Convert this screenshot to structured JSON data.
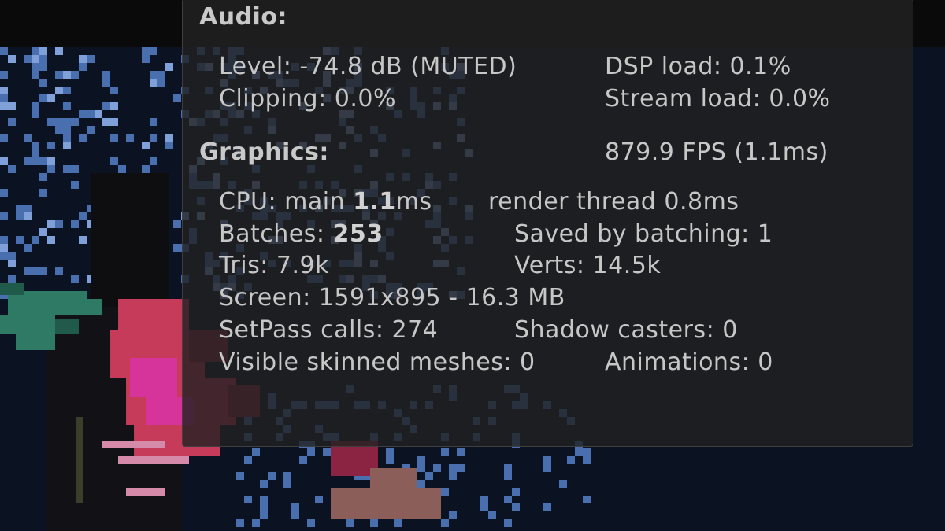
{
  "audio": {
    "heading": "Audio:",
    "level": "Level: -74.8 dB (MUTED)",
    "dsp_load": "DSP load: 0.1%",
    "clipping": "Clipping: 0.0%",
    "stream_load": "Stream load: 0.0%"
  },
  "graphics": {
    "heading": "Graphics:",
    "fps": "879.9 FPS (1.1ms)",
    "cpu_label": "CPU: main ",
    "cpu_main_value": "1.1",
    "cpu_main_unit": "ms",
    "render_thread": "render thread 0.8ms",
    "batches_label": "Batches: ",
    "batches_value": "253",
    "saved_by_batching": "Saved by batching: 1",
    "tris": "Tris: 7.9k",
    "verts": "Verts: 14.5k",
    "screen": "Screen: 1591x895 - 16.3 MB",
    "setpass_calls": "SetPass calls: 274",
    "shadow_casters": "Shadow casters: 0",
    "visible_skinned_meshes": "Visible skinned meshes: 0",
    "animations": "Animations: 0"
  },
  "colors": {
    "panel_background": "#222222",
    "panel_text": "#c7c7c7",
    "scene_background": "#0b1222",
    "foliage_blue": "#4a6fae",
    "leaf_green": "#2f7a64",
    "flower_red": "#c63a5a",
    "flower_magenta": "#d6349a"
  },
  "icons": {
    "background_art": "pixel-art-flower-scene"
  }
}
